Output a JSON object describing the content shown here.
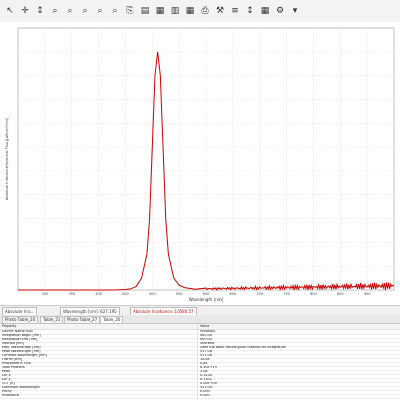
{
  "toolbar": {
    "tools": [
      {
        "name": "pointer-icon"
      },
      {
        "name": "move-icon"
      },
      {
        "name": "cursor-icon"
      },
      {
        "name": "zoom-in-icon"
      },
      {
        "name": "zoom-in-alt-icon"
      },
      {
        "name": "zoom-out-icon"
      },
      {
        "name": "zoom-fit-icon"
      },
      {
        "name": "zoom-reset-icon"
      },
      {
        "name": "copy-icon"
      },
      {
        "name": "page-icon"
      },
      {
        "name": "save-icon"
      },
      {
        "name": "export-icon"
      },
      {
        "name": "table-icon"
      },
      {
        "name": "print-icon"
      },
      {
        "name": "tools-icon"
      },
      {
        "name": "chart-icon"
      },
      {
        "name": "scale-icon"
      },
      {
        "name": "grid-icon"
      },
      {
        "name": "settings-icon"
      },
      {
        "name": "dropdown-icon"
      }
    ]
  },
  "chart_data": {
    "type": "line",
    "title": "",
    "xlabel": "Wavelength [nm]",
    "ylabel": "Absolute Irradiance/Spectral Flux [µW/cm²/nm]",
    "series": [
      {
        "color": "#cc0000",
        "x": [
          250,
          300,
          350,
          400,
          430,
          450,
          460,
          470,
          480,
          490,
          495,
          500,
          505,
          510,
          515,
          520,
          525,
          530,
          540,
          550,
          560,
          580,
          600,
          650,
          700,
          750,
          800,
          850,
          900,
          950
        ],
        "y": [
          0,
          0,
          0,
          0,
          0,
          0.2,
          0.5,
          1.5,
          5,
          15,
          30,
          60,
          90,
          100,
          90,
          60,
          30,
          15,
          5,
          2,
          1,
          0.3,
          0.2,
          0.2,
          0.3,
          0.4,
          0.6,
          1,
          1.5,
          2.5
        ]
      }
    ],
    "grid": true,
    "color_accent": "#cc0000"
  },
  "statusbar": {
    "item1": "Absolute Irra...",
    "item2": "Wavelength [nm]: 627.195",
    "item3": "Absolute Irradiance: 10580.57"
  },
  "tabs": [
    {
      "label": "Photo Table_20"
    },
    {
      "label": "Table_21"
    },
    {
      "label": "Photo Table_27"
    },
    {
      "label": "Table_26"
    }
  ],
  "table": {
    "headers": {
      "property": "Property",
      "value": "Value"
    },
    "rows": [
      {
        "property": "Device Name USB",
        "value": "HR4B881"
      },
      {
        "property": "Integration Begin [nm]",
        "value": "400.00"
      },
      {
        "property": "Integration End [nm]",
        "value": "900.00"
      },
      {
        "property": "Method [nm]",
        "value": "Shortest"
      },
      {
        "property": "Max. Wavelength [nm]",
        "value": "Uses the Basic Rectangular method for integration"
      },
      {
        "property": "Peak Wavelength [nm]",
        "value": "517.06"
      },
      {
        "property": "Centroid Wavelength [nm]",
        "value": "517.06"
      },
      {
        "property": "FWHM [nm]",
        "value": "14.65"
      },
      {
        "property": "Photometric Flux",
        "value": "0.84"
      },
      {
        "property": "Total Photons",
        "value": "6.30E+15"
      },
      {
        "property": "Peak",
        "value": "3.08"
      },
      {
        "property": "CIE x",
        "value": "0.1234"
      },
      {
        "property": "CIE y",
        "value": "0.7302"
      },
      {
        "property": "CCT [K]",
        "value": "0.00E+00"
      },
      {
        "property": "Dominant Wavelength",
        "value": "521.00"
      },
      {
        "property": "Purity",
        "value": "0.000"
      },
      {
        "property": "Irradiance",
        "value": "0.000"
      }
    ]
  }
}
